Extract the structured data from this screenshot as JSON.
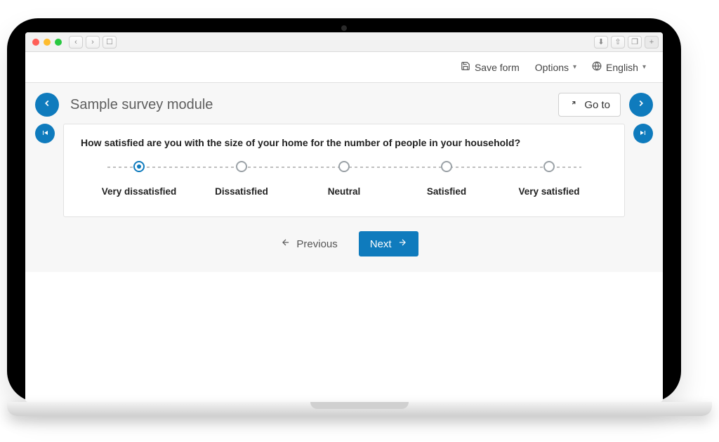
{
  "toolbar": {
    "save_label": "Save form",
    "options_label": "Options",
    "language_label": "English"
  },
  "survey": {
    "title": "Sample survey module",
    "goto_label": "Go to",
    "question": "How satisfied are you with the size of your home for the number of people in your household?",
    "options": [
      {
        "label": "Very dissatisfied",
        "selected": true
      },
      {
        "label": "Dissatisfied",
        "selected": false
      },
      {
        "label": "Neutral",
        "selected": false
      },
      {
        "label": "Satisfied",
        "selected": false
      },
      {
        "label": "Very satisfied",
        "selected": false
      }
    ],
    "prev_label": "Previous",
    "next_label": "Next"
  },
  "colors": {
    "accent": "#0f7bbd"
  }
}
